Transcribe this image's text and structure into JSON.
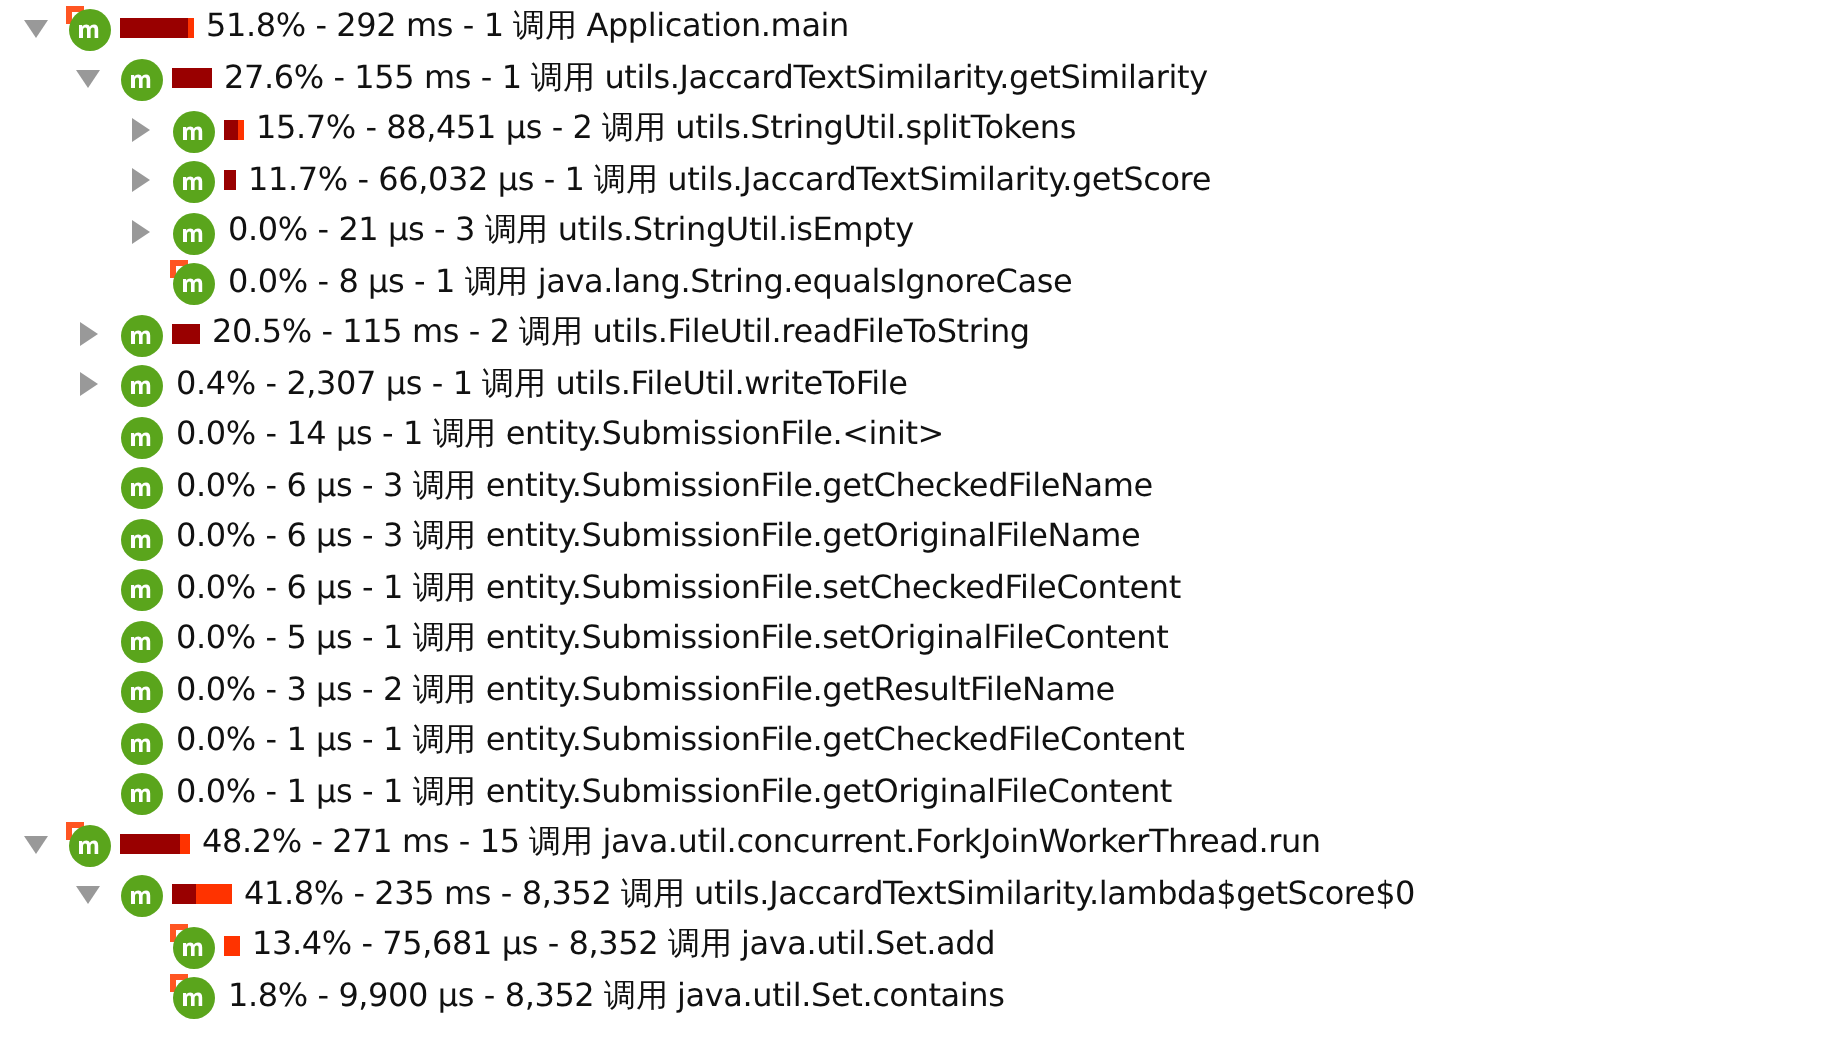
{
  "tree": [
    {
      "text": "51.8% - 292 ms - 1 调用 Application.main",
      "hot": true,
      "expanded": true,
      "bar": [
        {
          "color": "#990000"
        },
        {
          "color": "#ff3300"
        }
      ],
      "children": [
        {
          "text": "27.6% - 155 ms - 1 调用 utils.JaccardTextSimilarity.getSimilarity",
          "hot": false,
          "expanded": true,
          "bar": [
            {
              "color": "#990000"
            }
          ],
          "children": [
            {
              "text": "15.7% - 88,451 µs - 2 调用 utils.StringUtil.splitTokens",
              "hot": false,
              "expanded": false,
              "bar": [
                {
                  "color": "#990000"
                },
                {
                  "color": "#ff3300"
                }
              ]
            },
            {
              "text": "11.7% - 66,032 µs - 1 调用 utils.JaccardTextSimilarity.getScore",
              "hot": false,
              "expanded": false,
              "bar": [
                {
                  "color": "#990000"
                }
              ]
            },
            {
              "text": "0.0% - 21 µs - 3 调用 utils.StringUtil.isEmpty",
              "hot": false,
              "expanded": false
            },
            {
              "text": "0.0% - 8 µs - 1 调用 java.lang.String.equalsIgnoreCase",
              "hot": true
            }
          ]
        },
        {
          "text": "20.5% - 115 ms - 2 调用 utils.FileUtil.readFileToString",
          "hot": false,
          "expanded": false,
          "bar": [
            {
              "color": "#990000"
            }
          ]
        },
        {
          "text": "0.4% - 2,307 µs - 1 调用 utils.FileUtil.writeToFile",
          "hot": false,
          "expanded": false
        },
        {
          "text": "0.0% - 14 µs - 1 调用 entity.SubmissionFile.<init>",
          "hot": false
        },
        {
          "text": "0.0% - 6 µs - 3 调用 entity.SubmissionFile.getCheckedFileName",
          "hot": false
        },
        {
          "text": "0.0% - 6 µs - 3 调用 entity.SubmissionFile.getOriginalFileName",
          "hot": false
        },
        {
          "text": "0.0% - 6 µs - 1 调用 entity.SubmissionFile.setCheckedFileContent",
          "hot": false
        },
        {
          "text": "0.0% - 5 µs - 1 调用 entity.SubmissionFile.setOriginalFileContent",
          "hot": false
        },
        {
          "text": "0.0% - 3 µs - 2 调用 entity.SubmissionFile.getResultFileName",
          "hot": false
        },
        {
          "text": "0.0% - 1 µs - 1 调用 entity.SubmissionFile.getCheckedFileContent",
          "hot": false
        },
        {
          "text": "0.0% - 1 µs - 1 调用 entity.SubmissionFile.getOriginalFileContent",
          "hot": false
        }
      ]
    },
    {
      "text": "48.2% - 271 ms - 15 调用 java.util.concurrent.ForkJoinWorkerThread.run",
      "hot": true,
      "expanded": true,
      "bar": [
        {
          "color": "#990000"
        },
        {
          "color": "#ff3300"
        }
      ],
      "children": [
        {
          "text": "41.8% - 235 ms - 8,352 调用 utils.JaccardTextSimilarity.lambda$getScore$0",
          "hot": false,
          "expanded": true,
          "bar": [
            {
              "color": "#990000"
            },
            {
              "color": "#ff3300"
            }
          ],
          "children": [
            {
              "text": "13.4% - 75,681 µs - 8,352 调用 java.util.Set.add",
              "hot": true,
              "bar": [
                {
                  "color": "#ff3300"
                }
              ]
            },
            {
              "text": "1.8% - 9,900 µs - 8,352 调用 java.util.Set.contains",
              "hot": true
            }
          ]
        }
      ]
    }
  ]
}
